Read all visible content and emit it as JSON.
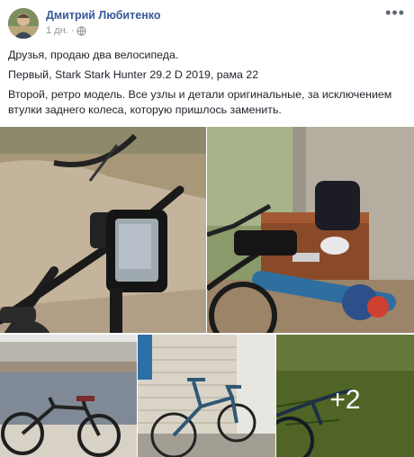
{
  "post": {
    "author": "Дмитрий Любитенко",
    "timestamp": "1 дн.",
    "privacy_icon": "globe-icon",
    "menu_icon": "more-options-icon",
    "lines": [
      "Друзья, продаю два велосипеда.",
      "Первый, Stark Stark Hunter 29.2 D 2019, рама 22",
      "Второй, ретро модель. Все узлы и детали оригинальные, за исключением втулки заднего колеса, которую пришлось заменить."
    ],
    "more_photos": "+2",
    "link_color": "#385898"
  }
}
